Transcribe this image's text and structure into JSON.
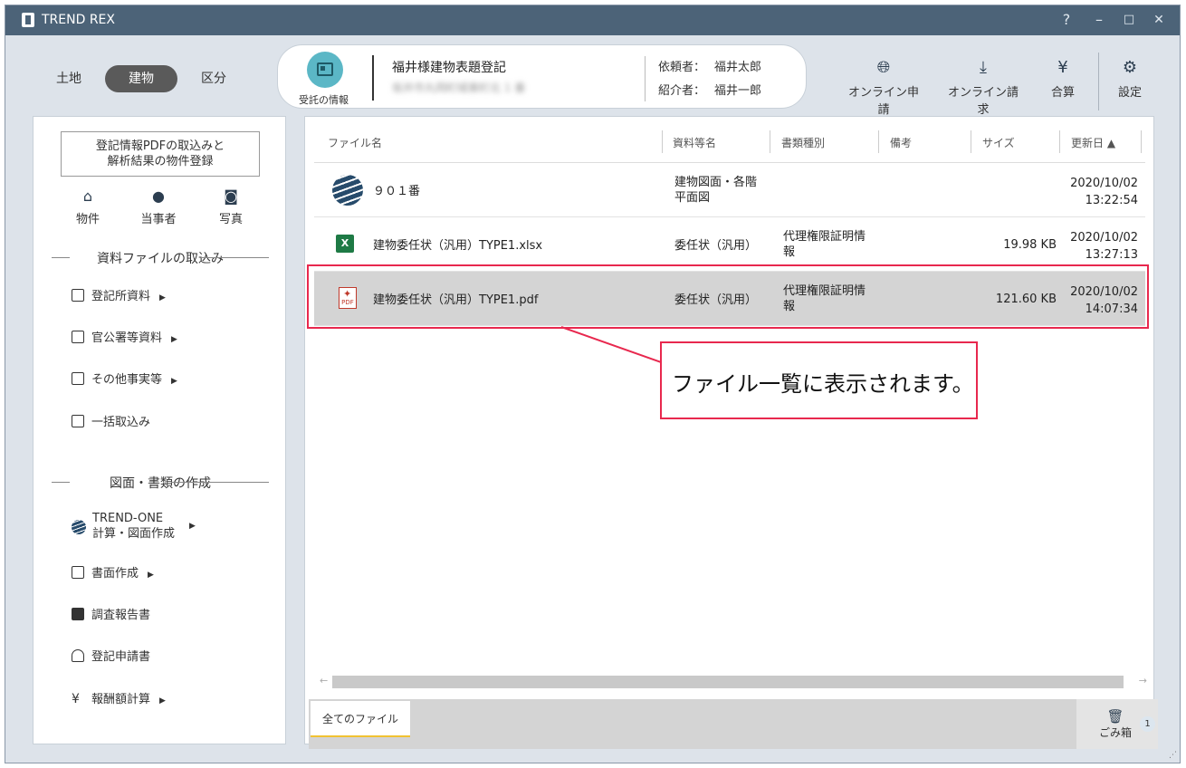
{
  "app": {
    "title": "TREND REX"
  },
  "window_controls": {
    "help": "?",
    "minimize": "–",
    "maximize": "□",
    "close": "✕"
  },
  "tabs": [
    {
      "label": "土地",
      "active": false
    },
    {
      "label": "建物",
      "active": true
    },
    {
      "label": "区分",
      "active": false
    }
  ],
  "case": {
    "icon_label": "受託の情報",
    "title": "福井様建物表題登記",
    "subtitle": "坂井市丸岡町城東町北 1 番",
    "requester_label": "依頼者：",
    "requester": "福井太郎",
    "introducer_label": "紹介者：",
    "introducer": "福井一郎"
  },
  "toolbar": {
    "online_apply": "オンライン申請",
    "online_request": "オンライン請求",
    "total": "合算",
    "settings": "設定"
  },
  "left": {
    "import_button": "登記情報PDFの取込みと\n解析結果の物件登録",
    "quick": {
      "property": "物件",
      "party": "当事者",
      "photo": "写真"
    },
    "section_import": "資料ファイルの取込み",
    "import_items": [
      "登記所資料",
      "官公署等資料",
      "その他事実等",
      "一括取込み"
    ],
    "section_create": "図面・書類の作成",
    "trend_one_line1": "TREND-ONE",
    "trend_one_line2": "計算・図面作成",
    "create_items": [
      "書面作成",
      "調査報告書",
      "登記申請書",
      "報酬額計算"
    ]
  },
  "files": {
    "columns": [
      "ファイル名",
      "資料等名",
      "書類種別",
      "備考",
      "サイズ",
      "更新日 ▲"
    ],
    "rows": [
      {
        "name": "９０１番",
        "doc": "建物図面・各階\n平面図",
        "type": "",
        "note": "",
        "size": "",
        "date": "2020/10/02",
        "time": "13:22:54",
        "icon": "trend-one-icon"
      },
      {
        "name": "建物委任状（汎用）TYPE1.xlsx",
        "doc": "委任状（汎用）",
        "type": "代理権限証明情\n報",
        "note": "",
        "size": "19.98 KB",
        "date": "2020/10/02",
        "time": "13:27:13",
        "icon": "excel-icon"
      },
      {
        "name": "建物委任状（汎用）TYPE1.pdf",
        "doc": "委任状（汎用）",
        "type": "代理権限証明情\n報",
        "note": "",
        "size": "121.60 KB",
        "date": "2020/10/02",
        "time": "14:07:34",
        "icon": "pdf-icon",
        "selected": true
      }
    ]
  },
  "callout": {
    "text": "ファイル一覧に表示されます。"
  },
  "footer": {
    "all_files_tab": "全てのファイル",
    "trash": "ごみ箱",
    "trash_count": "1"
  },
  "colors": {
    "titlebar": "#4c6378",
    "accent_red": "#e8284e",
    "active_tab": "#5a5a5a",
    "case_icon": "#5bb7c6"
  }
}
